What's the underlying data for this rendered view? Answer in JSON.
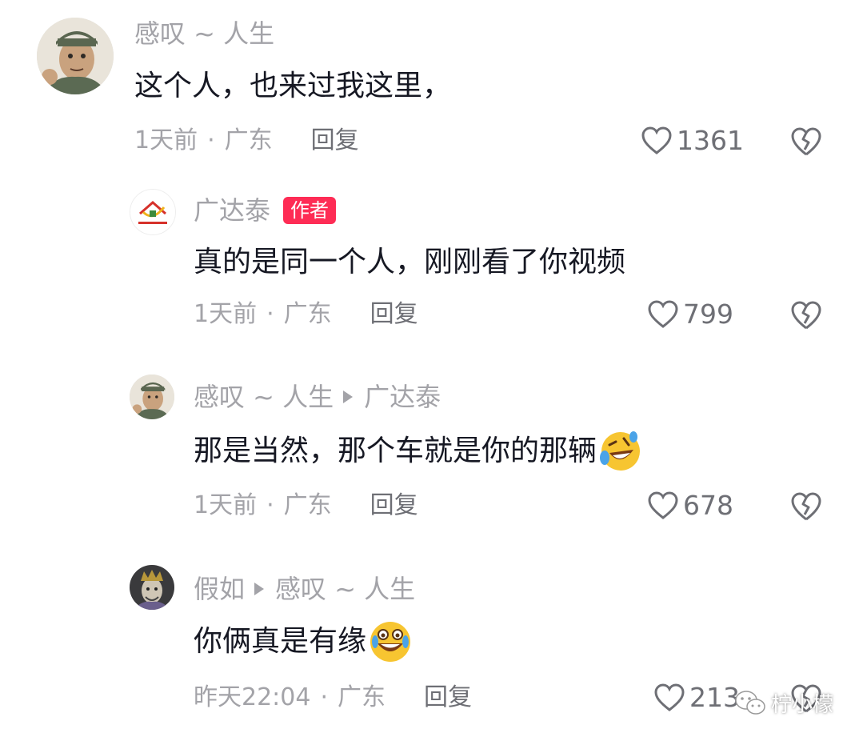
{
  "comments": [
    {
      "username": "感叹 ~ 人生",
      "text": "这个人，也来过我这里，",
      "time": "1天前",
      "location": "广东",
      "reply_label": "回复",
      "likes": "1361"
    },
    {
      "username": "广达泰",
      "author_tag": "作者",
      "text": "真的是同一个人，刚刚看了你视频",
      "time": "1天前",
      "location": "广东",
      "reply_label": "回复",
      "likes": "799"
    },
    {
      "username": "感叹 ~ 人生",
      "reply_to": "广达泰",
      "text": "那是当然，那个车就是你的那辆",
      "emoji": "rofl-emoji",
      "time": "1天前",
      "location": "广东",
      "reply_label": "回复",
      "likes": "678"
    },
    {
      "username": "假如",
      "reply_to": "感叹 ~ 人生",
      "text": "你俩真是有缘",
      "emoji": "tears-of-joy-emoji",
      "time": "昨天22:04",
      "location": "广东",
      "reply_label": "回复",
      "likes": "213"
    }
  ],
  "separator": "·",
  "watermark": "柠小檬",
  "colors": {
    "author_tag": "#fe2c55",
    "meta": "#a3a3a8",
    "text": "#161823"
  }
}
